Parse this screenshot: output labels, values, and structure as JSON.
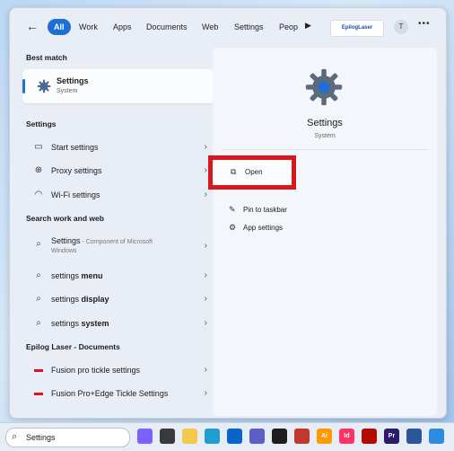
{
  "filters": {
    "back": "←",
    "tabs": [
      "All",
      "Work",
      "Apps",
      "Documents",
      "Web",
      "Settings",
      "Peop"
    ],
    "play": "▶",
    "org_logo": "EpilogLaser",
    "avatar_initial": "T",
    "more": "•••"
  },
  "left": {
    "best_match_header": "Best match",
    "best": {
      "title": "Settings",
      "subtitle": "System"
    },
    "settings_header": "Settings",
    "settings_items": [
      {
        "label": "Start settings",
        "icon": "start-settings-icon"
      },
      {
        "label": "Proxy settings",
        "icon": "proxy-icon"
      },
      {
        "label": "Wi-Fi settings",
        "icon": "wifi-icon"
      }
    ],
    "web_header": "Search work and web",
    "web_items": [
      {
        "label": "Settings",
        "sub": " - Component of Microsoft",
        "sub2": "Windows"
      },
      {
        "label_plain": "settings ",
        "label_bold": "menu"
      },
      {
        "label_plain": "settings ",
        "label_bold": "display"
      },
      {
        "label_plain": "settings ",
        "label_bold": "system"
      }
    ],
    "docs_header": "Epilog Laser - Documents",
    "doc_items": [
      {
        "label": "Fusion pro tickle settings"
      },
      {
        "label": "Fusion Pro+Edge Tickle Settings"
      }
    ]
  },
  "right": {
    "title": "Settings",
    "subtitle": "System",
    "actions": [
      "Open",
      "Pin to taskbar",
      "App settings"
    ]
  },
  "taskbar": {
    "search_value": "Settings",
    "apps": [
      {
        "name": "copilot",
        "color": "#7b61ff",
        "label": ""
      },
      {
        "name": "task-view",
        "color": "#3a3a3a",
        "label": ""
      },
      {
        "name": "file-explorer",
        "color": "#f2c94c",
        "label": ""
      },
      {
        "name": "edge",
        "color": "#1f9ed1",
        "label": ""
      },
      {
        "name": "outlook",
        "color": "#0a64c9",
        "label": ""
      },
      {
        "name": "teams",
        "color": "#5b5fc7",
        "label": ""
      },
      {
        "name": "terminal",
        "color": "#1e1e1e",
        "label": ""
      },
      {
        "name": "epilog",
        "color": "#c0392b",
        "label": ""
      },
      {
        "name": "illustrator",
        "color": "#ff9a00",
        "label": "Ai"
      },
      {
        "name": "indesign",
        "color": "#ff3366",
        "label": "Id"
      },
      {
        "name": "acrobat",
        "color": "#b30b00",
        "label": ""
      },
      {
        "name": "premiere",
        "color": "#2c1a6e",
        "label": "Pr"
      },
      {
        "name": "word",
        "color": "#2b579a",
        "label": ""
      },
      {
        "name": "photos",
        "color": "#2d8ce0",
        "label": ""
      }
    ]
  }
}
